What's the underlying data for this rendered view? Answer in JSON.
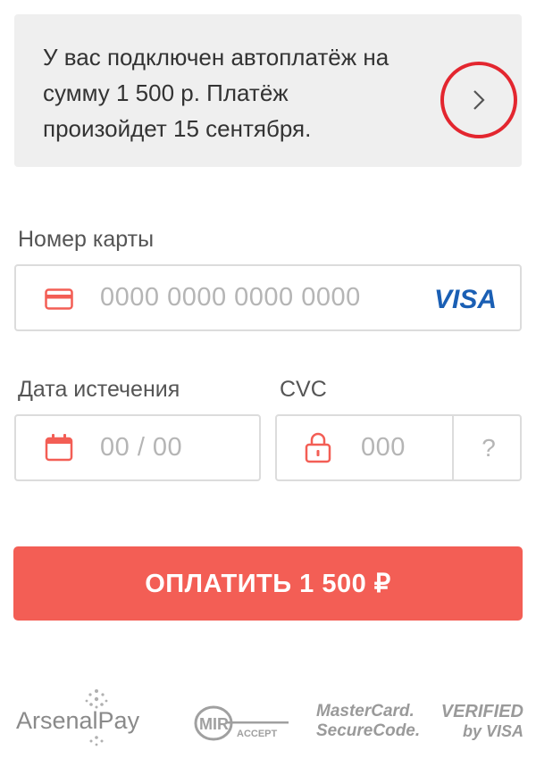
{
  "notice": {
    "text": "У вас подключен автоплатёж на сумму 1 500 р. Платёж произойдет 15 сентября.",
    "arrow_icon": "chevron-right-icon"
  },
  "card": {
    "label": "Номер карты",
    "placeholder": "0000 0000 0000 0000",
    "icon": "credit-card-icon",
    "brand": "VISA"
  },
  "expiry": {
    "label": "Дата истечения",
    "placeholder": "00 / 00",
    "icon": "calendar-icon"
  },
  "cvc": {
    "label": "CVC",
    "placeholder": "000",
    "icon": "lock-icon",
    "help": "?"
  },
  "pay_button": {
    "label": "ОПЛАТИТЬ 1 500 ₽"
  },
  "footer_logos": {
    "arsenalpay": "ArsenalPay",
    "mir_accept": {
      "mir": "MIR",
      "accept": "ACCEPT"
    },
    "mastercard": {
      "line1": "MasterCard.",
      "line2": "SecureCode."
    },
    "verified_visa": {
      "line1": "VERIFIED",
      "line2": "by VISA"
    }
  },
  "colors": {
    "accent": "#f35e55",
    "highlight_ring": "#e3262f",
    "visa_blue": "#1a5fb4",
    "placeholder": "#b5b5b5"
  }
}
